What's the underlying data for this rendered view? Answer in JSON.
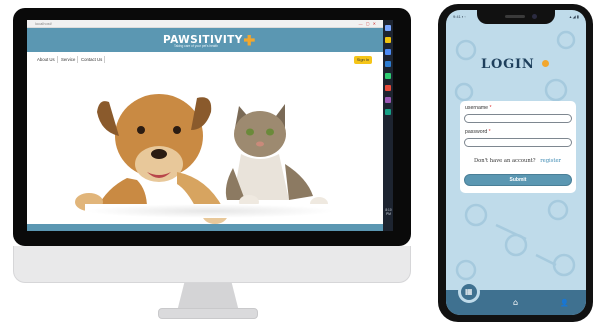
{
  "desktop": {
    "browser": {
      "url": "localhost/"
    },
    "site": {
      "brand": {
        "name": "PAWSITIVITY",
        "tagline": "Taking care of your pet's health"
      },
      "nav": [
        {
          "label": "About Us"
        },
        {
          "label": "Service"
        },
        {
          "label": "Contact Us"
        }
      ],
      "signup_label": "Sign In"
    },
    "taskbar": {
      "time": "8:10",
      "date": "PM"
    }
  },
  "phone": {
    "status": {
      "left": "9:41 ▪ ◦",
      "right": "▴ ◢ ▮"
    },
    "login": {
      "title": "LOGIN",
      "username_label": "username",
      "password_label": "password",
      "required_mark": "*",
      "no_account_text": "Don't have an account?",
      "register_label": "register",
      "submit_label": "Submit"
    },
    "bottom_nav": [
      {
        "icon": "grid-icon",
        "glyph": "▦",
        "active": true
      },
      {
        "icon": "home-icon",
        "glyph": "⌂",
        "active": false
      },
      {
        "icon": "user-icon",
        "glyph": "👤",
        "active": false
      }
    ]
  },
  "colors": {
    "brand_blue": "#5b97b2",
    "accent_orange": "#f2a72e",
    "phone_bg": "#bfdbea",
    "nav_dark": "#3f7190"
  }
}
